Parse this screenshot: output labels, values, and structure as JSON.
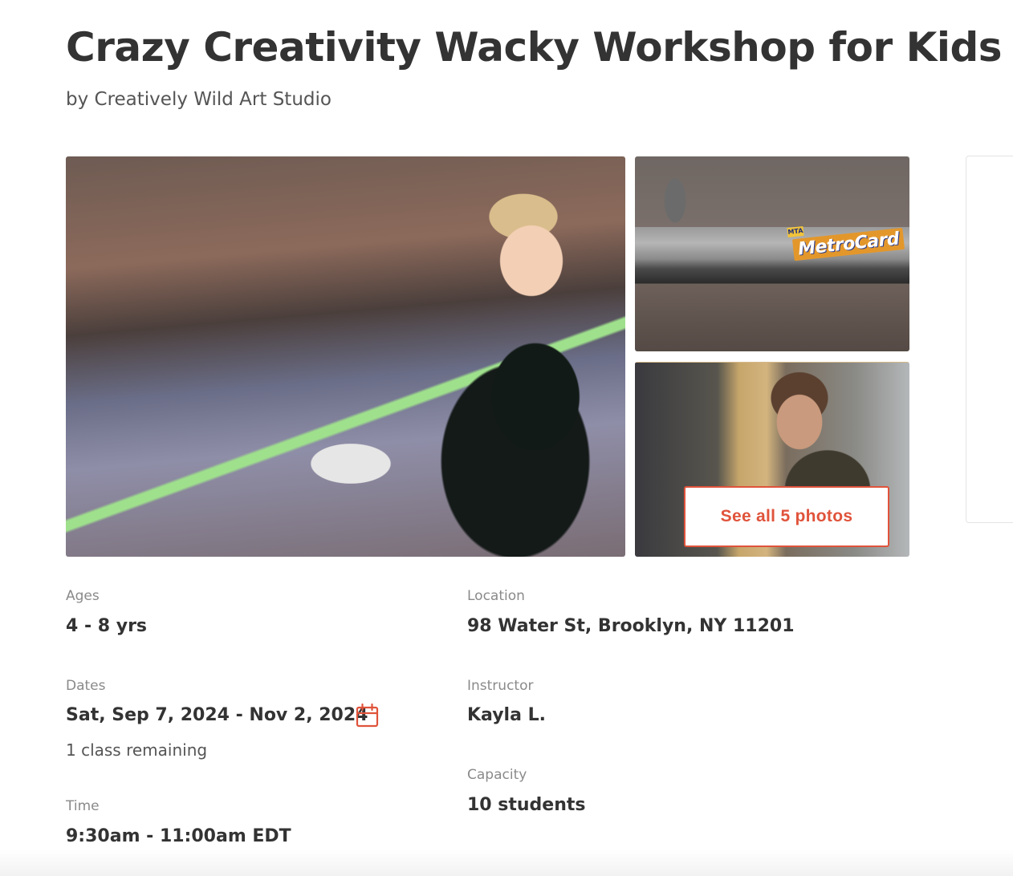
{
  "listing": {
    "title": "Crazy Creativity Wacky Workshop for Kids",
    "provider": "by Creatively Wild Art Studio"
  },
  "gallery": {
    "see_all_label": "See all 5 photos",
    "metrocard_text": "MetroCard",
    "metrocard_badge": "MTA"
  },
  "details": {
    "ages": {
      "label": "Ages",
      "value": "4 - 8 yrs"
    },
    "dates": {
      "label": "Dates",
      "value": "Sat, Sep 7, 2024 - Nov 2, 2024",
      "remaining": "1 class remaining"
    },
    "time": {
      "label": "Time",
      "value": "9:30am - 11:00am EDT"
    },
    "location": {
      "label": "Location",
      "value": "98 Water St, Brooklyn, NY 11201"
    },
    "instructor": {
      "label": "Instructor",
      "value": "Kayla L."
    },
    "capacity": {
      "label": "Capacity",
      "value": "10 students"
    }
  },
  "icons": {
    "calendar": "calendar-icon"
  },
  "colors": {
    "accent": "#e0533b",
    "text": "#333333",
    "label": "#8a8a8a"
  }
}
